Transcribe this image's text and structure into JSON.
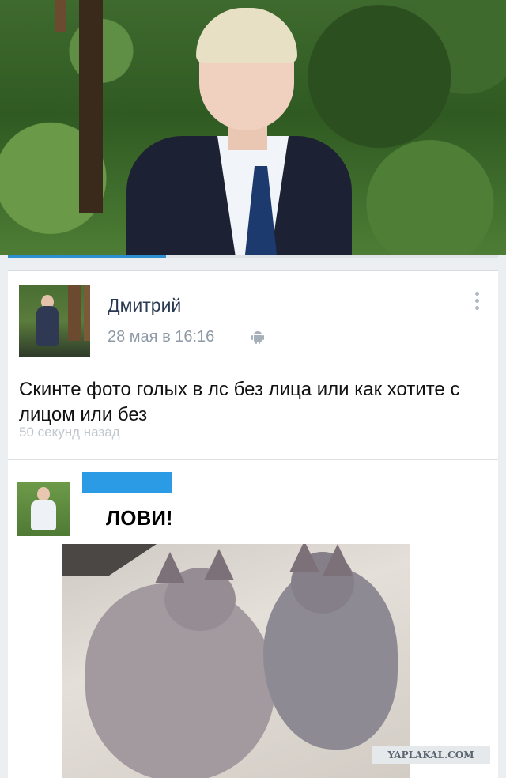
{
  "post": {
    "author_name": "Дмитрий",
    "timestamp": "28 мая в 16:16",
    "text": "Скинте фото голых в лс без лица или как хотите с лицом или без",
    "ghost_time": "50 секунд назад"
  },
  "comment": {
    "text": "ЛОВИ!"
  },
  "watermark": "YAPLAKAL.COM",
  "colors": {
    "accent_blue": "#2c9be6",
    "name_text": "#2a3a52",
    "meta_text": "#8e9aa6"
  },
  "icons": [
    "android-icon",
    "more-vertical-icon"
  ]
}
